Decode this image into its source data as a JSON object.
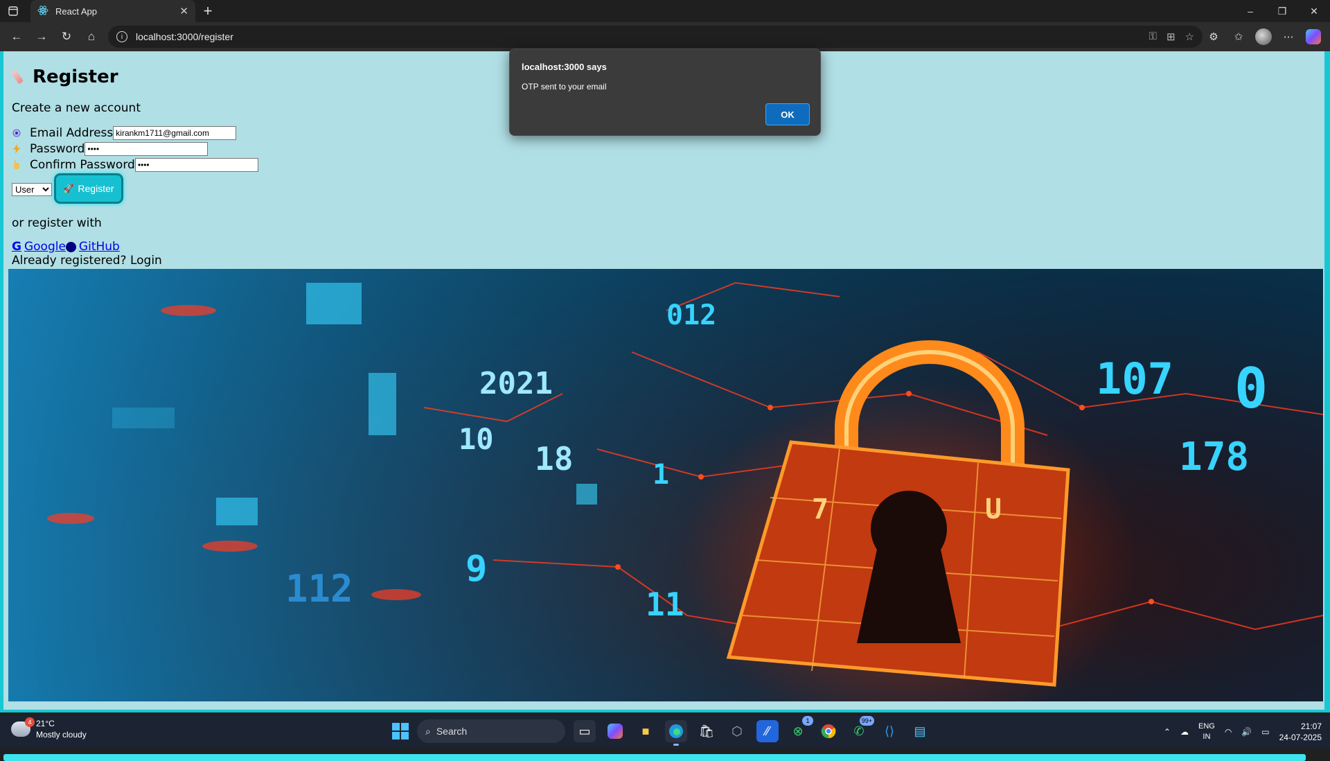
{
  "browser": {
    "tab_title": "React App",
    "url": "localhost:3000/register",
    "window_controls": {
      "minimize": "–",
      "restore": "❐",
      "close": "✕"
    }
  },
  "page": {
    "title": "Register",
    "subtitle": "Create a new account",
    "fields": {
      "email": {
        "label": "Email Address",
        "value": "kirankm1711@gmail.com"
      },
      "password": {
        "label": "Password",
        "value": "••••"
      },
      "confirm": {
        "label": "Confirm Password",
        "value": "••••"
      }
    },
    "role_select": {
      "selected": "User"
    },
    "register_button": "Register",
    "or_register": "or register with",
    "social": {
      "google": "Google",
      "github": "GitHub"
    },
    "already": "Already registered? Login"
  },
  "hero_digits": [
    "107",
    "0",
    "178",
    "2021",
    "18",
    "1",
    "10",
    "012",
    "9",
    "112",
    "11",
    "7",
    "U"
  ],
  "alert": {
    "title": "localhost:3000 says",
    "message": "OTP sent to your email",
    "ok": "OK"
  },
  "taskbar": {
    "temperature": "21°C",
    "weather": "Mostly cloudy",
    "weather_badge": "4",
    "search": "Search",
    "xbox_badge": "1",
    "whatsapp_badge": "99+",
    "lang_1": "ENG",
    "lang_2": "IN",
    "time": "21:07",
    "date": "24-07-2025"
  },
  "colors": {
    "page_bg": "#b0dfe5",
    "accent": "#17c0d1",
    "dialog_bg": "#3b3b3b",
    "ok_button": "#0f6cbd"
  }
}
